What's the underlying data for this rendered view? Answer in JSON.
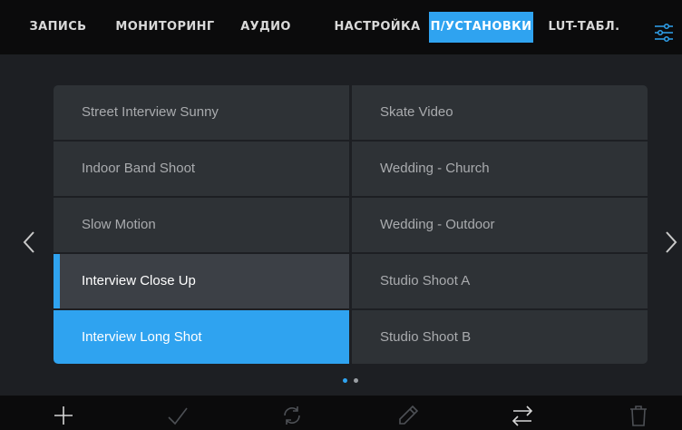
{
  "tabs": [
    {
      "label": "ЗАПИСЬ",
      "active": false
    },
    {
      "label": "МОНИТОРИНГ",
      "active": false
    },
    {
      "label": "АУДИО",
      "active": false
    },
    {
      "label": "НАСТРОЙКА",
      "active": false
    },
    {
      "label": "П/УСТАНОВКИ",
      "active": true
    },
    {
      "label": "LUT-ТАБЛ.",
      "active": false
    }
  ],
  "menu_icon": "sliders-icon",
  "presets": {
    "left": [
      "Street Interview Sunny",
      "Indoor Band Shoot",
      "Slow Motion",
      "Interview Close Up",
      "Interview Long Shot"
    ],
    "right": [
      "Skate Video",
      "Wedding  - Church",
      "Wedding - Outdoor",
      "Studio Shoot A",
      "Studio Shoot B"
    ],
    "highlighted": "Interview Close Up",
    "selected": "Interview Long Shot"
  },
  "pagination": {
    "pages": 2,
    "current": 1
  },
  "toolbar": {
    "icons": [
      "add-icon",
      "check-icon",
      "refresh-icon",
      "pencil-icon",
      "swap-arrows-icon",
      "trash-icon"
    ],
    "enabled": [
      true,
      false,
      false,
      false,
      true,
      false
    ]
  },
  "colors": {
    "accent": "#2fa3f0",
    "background": "#1d1f23",
    "cell": "#2e3236",
    "cell_highlight": "#3c4046",
    "bar": "#0b0b0c"
  }
}
